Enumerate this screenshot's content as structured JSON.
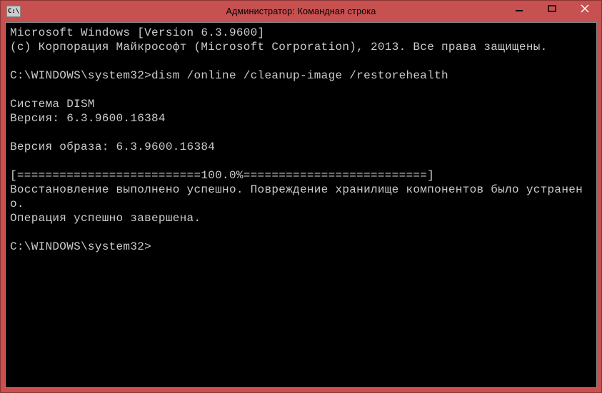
{
  "window": {
    "title": "Администратор: Командная строка",
    "icon_label": "C:\\"
  },
  "terminal": {
    "lines": [
      "Microsoft Windows [Version 6.3.9600]",
      "(c) Корпорация Майкрософт (Microsoft Corporation), 2013. Все права защищены.",
      "",
      "C:\\WINDOWS\\system32>dism /online /cleanup-image /restorehealth",
      "",
      "Cистема DISM",
      "Версия: 6.3.9600.16384",
      "",
      "Версия образа: 6.3.9600.16384",
      "",
      "[==========================100.0%==========================]",
      "Восстановление выполнено успешно. Повреждение хранилище компонентов было устранено.",
      "Операция успешно завершена.",
      "",
      "C:\\WINDOWS\\system32>"
    ]
  }
}
